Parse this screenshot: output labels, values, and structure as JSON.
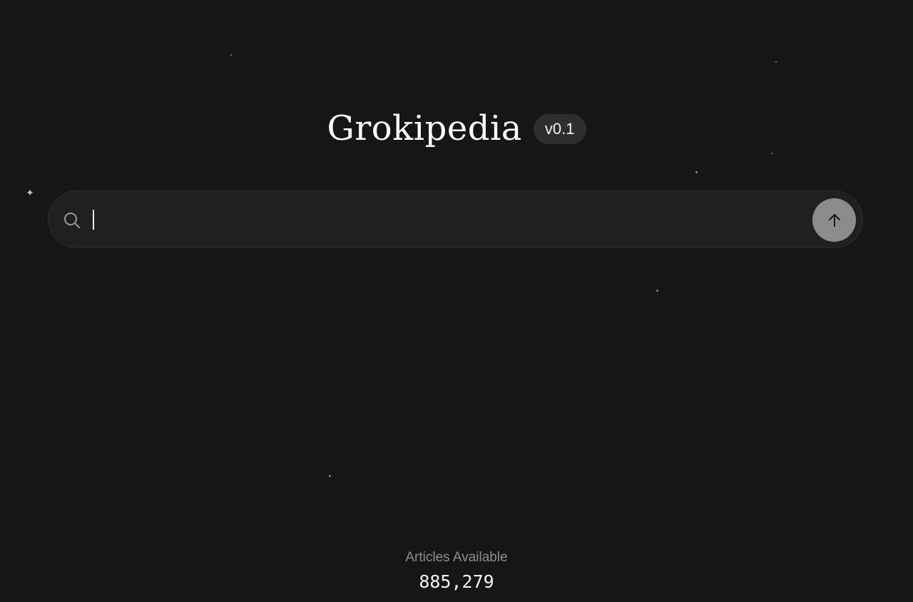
{
  "header": {
    "title": "Grokipedia",
    "version": "v0.1"
  },
  "search": {
    "value": "",
    "placeholder": "",
    "search_icon": "search-icon",
    "submit_icon": "arrow-up-icon"
  },
  "footer": {
    "label": "Articles Available",
    "count": "885,279"
  },
  "colors": {
    "background": "#161616",
    "search_bg": "#202020",
    "badge_bg": "#2e2e2e",
    "submit_button": "#8c8c8c"
  }
}
